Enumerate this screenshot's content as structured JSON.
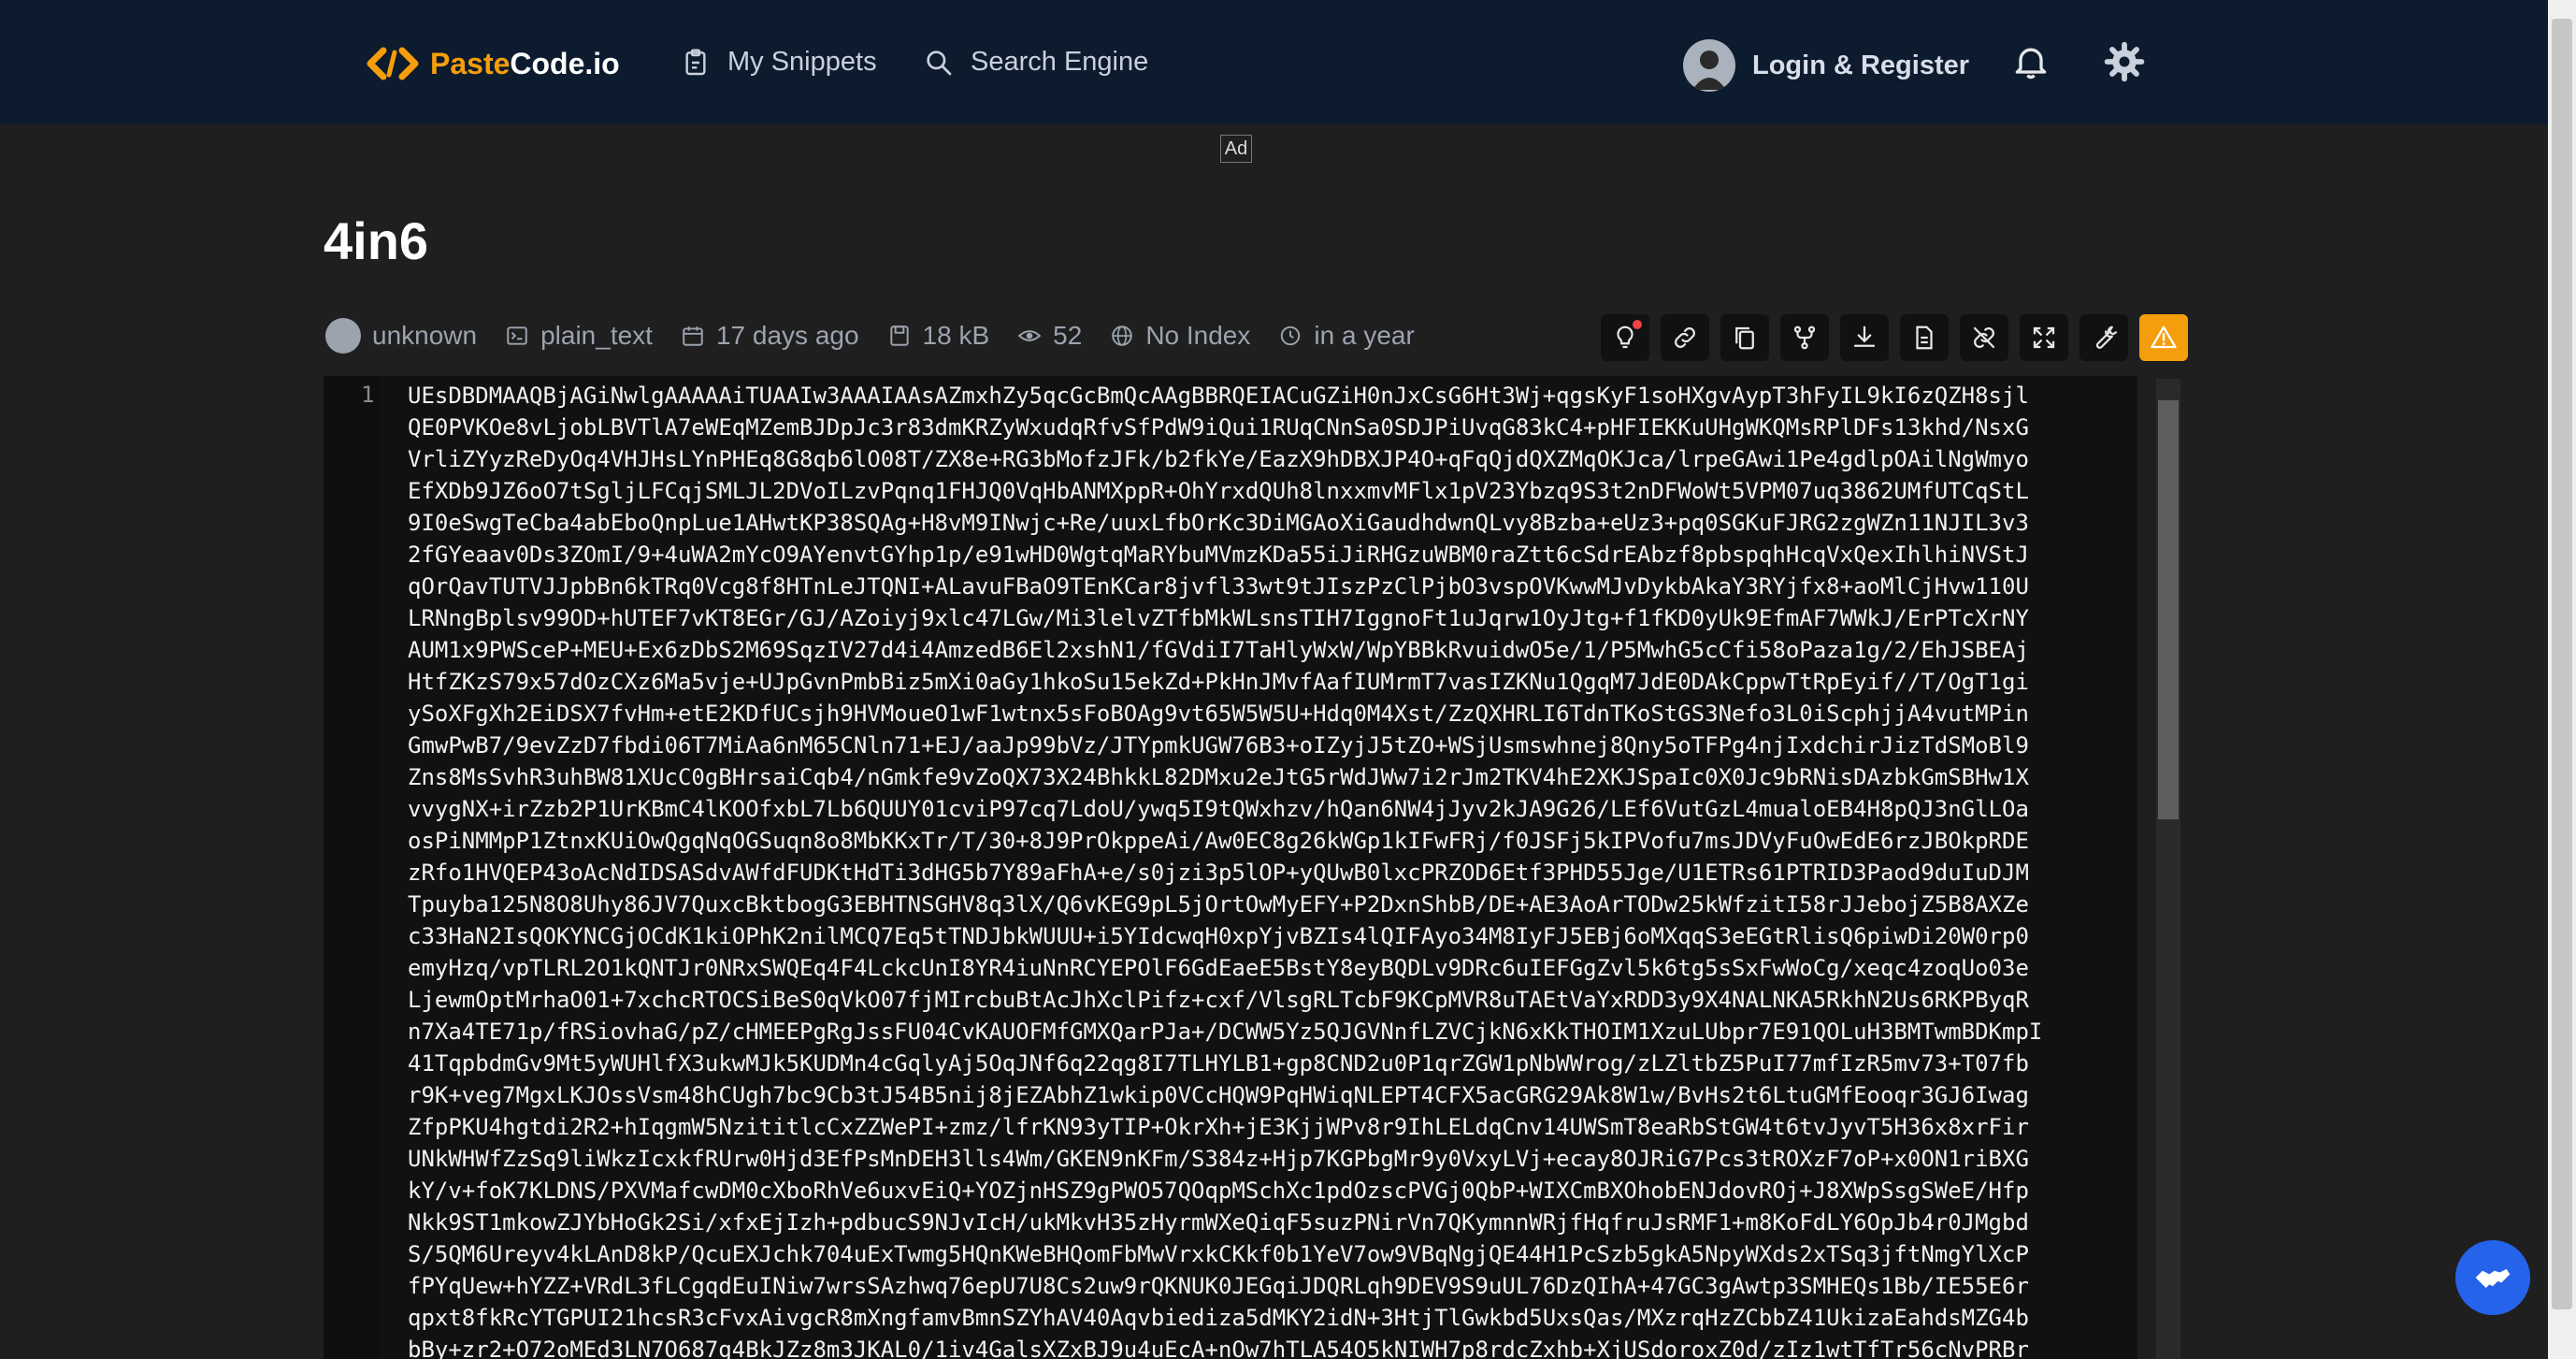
{
  "header": {
    "logo_paste": "Paste",
    "logo_code": "Code.io",
    "nav": [
      {
        "label": "My Snippets",
        "icon": "clipboard-icon"
      },
      {
        "label": "Search Engine",
        "icon": "search-icon"
      }
    ],
    "login_label": "Login & Register",
    "icons": [
      "bell-icon",
      "gear-icon"
    ]
  },
  "ad_label": "Ad",
  "paste": {
    "title": "4in6",
    "meta": {
      "author": "unknown",
      "syntax": "plain_text",
      "created": "17 days ago",
      "size": "18 kB",
      "views": "52",
      "index": "No Index",
      "expires": "in a year"
    },
    "toolbar_icons": [
      "lightbulb-icon",
      "link-icon",
      "copy-icon",
      "fork-icon",
      "download-icon",
      "file-icon",
      "unlink-icon",
      "fullscreen-icon",
      "wrench-icon",
      "warning-icon"
    ]
  },
  "code": {
    "line_number": "1",
    "lines": [
      "UEsDBDMAAQBjAGiNwlgAAAAAiTUAAIw3AAAIAAsAZmxhZy5qcGcBmQcAAgBBRQEIACuGZiH0nJxCsG6Ht3Wj+qgsKyF1soHXgvAypT3hFyIL9kI6zQZH8sjl",
      "QE0PVKOe8vLjobLBVTlA7eWEqMZemBJDpJc3r83dmKRZyWxudqRfvSfPdW9iQui1RUqCNnSa0SDJPiUvqG83kC4+pHFIEKKuUHgWKQMsRPlDFs13khd/NsxG",
      "VrliZYyzReDyOq4VHJHsLYnPHEq8G8qb6lO08T/ZX8e+RG3bMofzJFk/b2fkYe/EazX9hDBXJP4O+qFqQjdQXZMqOKJca/lrpeGAwi1Pe4gdlpOAilNgWmyo",
      "EfXDb9JZ6oO7tSgljLFCqjSMLJL2DVoILzvPqnq1FHJQ0VqHbANMXppR+OhYrxdQUh8lnxxmvMFlx1pV23Ybzq9S3t2nDFWoWt5VPM07uq3862UMfUTCqStL",
      "9I0eSwgTeCba4abEboQnpLue1AHwtKP38SQAg+H8vM9INwjc+Re/uuxLfbOrKc3DiMGAoXiGaudhdwnQLvy8Bzba+eUz3+pq0SGKuFJRG2zgWZn11NJIL3v3",
      "2fGYeaav0Ds3ZOmI/9+4uWA2mYcO9AYenvtGYhp1p/e91wHD0WgtqMaRYbuMVmzKDa55iJiRHGzuWBM0raZtt6cSdrEAbzf8pbspqhHcqVxQexIhlhiNVStJ",
      "qOrQavTUTVJJpbBn6kTRq0Vcg8f8HTnLeJTQNI+ALavuFBaO9TEnKCar8jvfl33wt9tJIszPzClPjbO3vspOVKwwMJvDykbAkaY3RYjfx8+aoMlCjHvw110U",
      "LRNngBplsv99OD+hUTEF7vKT8EGr/GJ/AZoiyj9xlc47LGw/Mi3lelvZTfbMkWLsnsTIH7IggnoFt1uJqrw1OyJtg+f1fKD0yUk9EfmAF7WWkJ/ErPTcXrNY",
      "AUM1x9PWSceP+MEU+Ex6zDbS2M69SqzIV27d4i4AmzedB6El2xshN1/fGVdiI7TaHlyWxW/WpYBBkRvuidwO5e/1/P5MwhG5cCfi58oPaza1g/2/EhJSBEAj",
      "HtfZKzS79x57dOzCXz6Ma5vje+UJpGvnPmbBiz5mXi0aGy1hkoSu15ekZd+PkHnJMvfAafIUMrmT7vasIZKNu1QgqM7JdE0DAkCppwTtRpEyif//T/OgT1gi",
      "ySoXFgXh2EiDSX7fvHm+etE2KDfUCsjh9HVMoueO1wF1wtnx5sFoBOAg9vt65W5W5U+Hdq0M4Xst/ZzQXHRLI6TdnTKoStGS3Nefo3L0iScphjjA4vutMPin",
      "GmwPwB7/9evZzD7fbdi06T7MiAa6nM65CNln71+EJ/aaJp99bVz/JTYpmkUGW76B3+oIZyjJ5tZO+WSjUsmswhnej8Qny5oTFPg4njIxdchirJizTdSMoBl9",
      "Zns8MsSvhR3uhBW81XUcC0gBHrsaiCqb4/nGmkfe9vZoQX73X24BhkkL82DMxu2eJtG5rWdJWw7i2rJm2TKV4hE2XKJSpaIc0X0Jc9bRNisDAzbkGmSBHw1X",
      "vvygNX+irZzb2P1UrKBmC4lKOOfxbL7Lb6QUUY01cviP97cq7LdoU/ywq5I9tQWxhzv/hQan6NW4jJyv2kJA9G26/LEf6VutGzL4mualoEB4H8pQJ3nGlLOa",
      "osPiNMMpP1ZtnxKUiOwQgqNqOGSuqn8o8MbKKxTr/T/30+8J9PrOkppeAi/Aw0EC8g26kWGp1kIFwFRj/f0JSFj5kIPVofu7msJDVyFuOwEdE6rzJBOkpRDE",
      "zRfo1HVQEP43oAcNdIDSASdvAWfdFUDKtHdTi3dHG5b7Y89aFhA+e/s0jzi3p5lOP+yQUwB0lxcPRZOD6Etf3PHD55Jge/U1ETRs61PTRID3Paod9duIuDJM",
      "Tpuyba125N8O8Uhy86JV7QuxcBktbogG3EBHTNSGHV8q3lX/Q6vKEG9pL5jOrtOwMyEFY+P2DxnShbB/DE+AE3AoArTODw25kWfzitI58rJJebojZ5B8AXZe",
      "c33HaN2IsQOKYNCGjOCdK1kiOPhK2nilMCQ7Eq5tTNDJbkWUUU+i5YIdcwqH0xpYjvBZIs4lQIFAyo34M8IyFJ5EBj6oMXqqS3eEGtRlisQ6piwDi20W0rp0",
      "emyHzq/vpTLRL2O1kQNTJr0NRxSWQEq4F4LckcUnI8YR4iuNnRCYEPOlF6GdEaeE5BstY8eyBQDLv9DRc6uIEFGgZvl5k6tg5sSxFwWoCg/xeqc4zoqUo03e",
      "LjewmOptMrhaO01+7xchcRTOCSiBeS0qVkO07fjMIrcbuBtAcJhXclPifz+cxf/VlsgRLTcbF9KCpMVR8uTAEtVaYxRDD3y9X4NALNKA5RkhN2Us6RKPByqR",
      "n7Xa4TE71p/fRSiovhaG/pZ/cHMEEPgRgJssFU04CvKAUOFMfGMXQarPJa+/DCWW5Yz5QJGVNnfLZVCjkN6xKkTHOIM1XzuLUbpr7E91QOLuH3BMTwmBDKmpI",
      "41TqpbdmGv9Mt5yWUHlfX3ukwMJk5KUDMn4cGqlyAj5OqJNf6q22qg8I7TLHYLB1+gp8CND2u0P1qrZGW1pNbWWrog/zLZltbZ5PuI77mfIzR5mv73+T07fb",
      "r9K+veg7MgxLKJOssVsm48hCUgh7bc9Cb3tJ54B5nij8jEZAbhZ1wkip0VCcHQW9PqHWiqNLEPT4CFX5acGRG29Ak8W1w/BvHs2t6LtuGMfEooqr3GJ6Iwag",
      "ZfpPKU4hgtdi2R2+hIqgmW5NzititlcCxZZWePI+zmz/lfrKN93yTIP+OkrXh+jE3KjjWPv8r9IhLELdqCnv14UWSmT8eaRbStGW4t6tvJyvT5H36x8xrFir",
      "UNkWHWfZzSq9liWkzIcxkfRUrw0Hjd3EfPsMnDEH3lls4Wm/GKEN9nKFm/S384z+Hjp7KGPbgMr9y0VxyLVj+ecay8OJRiG7Pcs3tROXzF7oP+x0ON1riBXG",
      "kY/v+foK7KLDNS/PXVMafcwDM0cXboRhVe6uxvEiQ+YOZjnHSZ9gPWO57QOqpMSchXc1pdOzscPVGj0QbP+WIXCmBXOhobENJdovROj+J8XWpSsgSWeE/Hfp",
      "Nkk9ST1mkowZJYbHoGk2Si/xfxEjIzh+pdbucS9NJvIcH/ukMkvH35zHyrmWXeQiqF5suzPNirVn7QKymnnWRjfHqfruJsRMF1+m8KoFdLY6OpJb4r0JMgbd",
      "S/5QM6Ureyv4kLAnD8kP/QcuEXJchk704uExTwmg5HQnKWeBHQomFbMwVrxkCKkf0b1YeV7ow9VBqNgjQE44H1PcSzb5gkA5NpyWXds2xTSq3jftNmgYlXcP",
      "fPYqUew+hYZZ+VRdL3fLCgqdEuINiw7wrsSAzhwq76epU7U8Cs2uw9rQKNUK0JEGqiJDQRLqh9DEV9S9uUL76DzQIhA+47GC3gAwtp3SMHEQs1Bb/IE55E6r",
      "qpxt8fkRcYTGPUI21hcsR3cFvxAivgcR8mXngfamvBmnSZYhAV40Aqvbiediza5dMKY2idN+3HtjTlGwkbd5UxsQas/MXzrqHzZCbbZ41UkizaEahdsMZG4b",
      "bBy+zr2+O72oMEd3LN7O687g4BkJZz8m3JKAL0/1iv4GalsXZxBJ9u4uEcA+nOw7hTLA54O5kNIWH7p8rdcZxhb+XjUSdoroxZ0d/zIz1wtTfTr56cNvPRBr"
    ]
  }
}
